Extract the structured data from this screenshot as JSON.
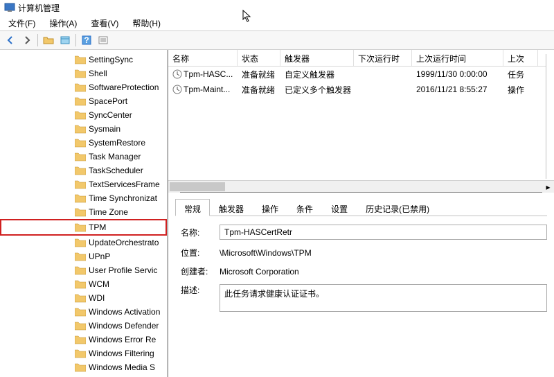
{
  "window": {
    "title": "计算机管理"
  },
  "menu": {
    "file": "文件(F)",
    "action": "操作(A)",
    "view": "查看(V)",
    "help": "帮助(H)"
  },
  "tree": {
    "items": [
      "SettingSync",
      "Shell",
      "SoftwareProtection",
      "SpacePort",
      "SyncCenter",
      "Sysmain",
      "SystemRestore",
      "Task Manager",
      "TaskScheduler",
      "TextServicesFrame",
      "Time Synchronizat",
      "Time Zone",
      "TPM",
      "UpdateOrchestrato",
      "UPnP",
      "User Profile Servic",
      "WCM",
      "WDI",
      "Windows Activation",
      "Windows Defender",
      "Windows Error Re",
      "Windows Filtering",
      "Windows Media S"
    ],
    "selected_index": 12
  },
  "list": {
    "columns": [
      "名称",
      "状态",
      "触发器",
      "下次运行时间",
      "上次运行时间",
      "上次"
    ],
    "rows": [
      {
        "name": "Tpm-HASC...",
        "status": "准备就绪",
        "trigger": "自定义触发器",
        "next": "",
        "last": "1999/11/30 0:00:00",
        "result": "任务"
      },
      {
        "name": "Tpm-Maint...",
        "status": "准备就绪",
        "trigger": "已定义多个触发器",
        "next": "",
        "last": "2016/11/21 8:55:27",
        "result": "操作"
      }
    ]
  },
  "details": {
    "tabs": [
      "常规",
      "触发器",
      "操作",
      "条件",
      "设置",
      "历史记录(已禁用)"
    ],
    "active_tab": 0,
    "labels": {
      "name": "名称:",
      "location": "位置:",
      "author": "创建者:",
      "desc": "描述:"
    },
    "values": {
      "name": "Tpm-HASCertRetr",
      "location": "\\Microsoft\\Windows\\TPM",
      "author": "Microsoft Corporation",
      "desc": "此任务请求健康认证证书。"
    }
  }
}
